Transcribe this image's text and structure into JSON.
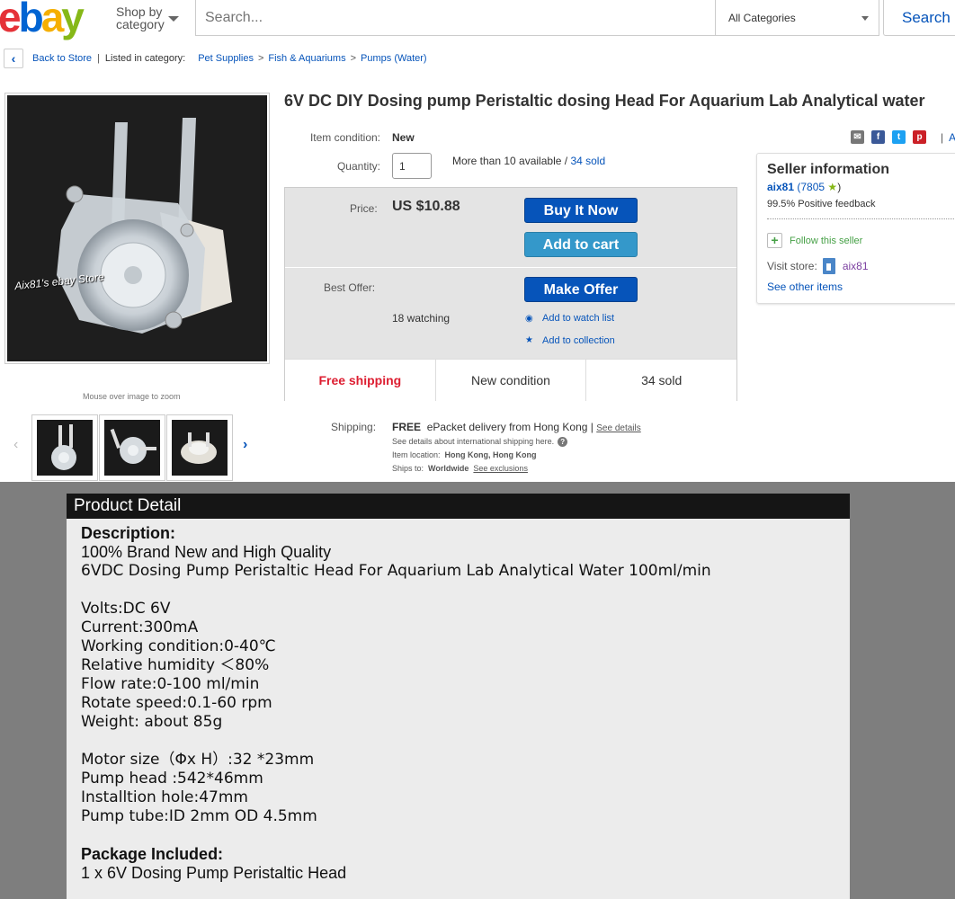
{
  "header": {
    "logo_letters": [
      "e",
      "b",
      "a",
      "y"
    ],
    "logo_colors": [
      "#e53238",
      "#0064d2",
      "#f5af02",
      "#86b817"
    ],
    "shop_by_line1": "Shop by",
    "shop_by_line2": "category",
    "search_placeholder": "Search...",
    "category_select": "All Categories",
    "search_button": "Search"
  },
  "breadcrumb": {
    "back": "Back to Store",
    "listed_in": "Listed in category:",
    "categories": [
      "Pet Supplies",
      "Fish & Aquariums",
      "Pumps (Water)"
    ]
  },
  "gallery": {
    "watermark": "Aix81's ebay Store",
    "zoom_hint": "Mouse over image to zoom"
  },
  "listing": {
    "title": "6V DC DIY Dosing pump Peristaltic dosing Head For Aquarium Lab Analytical water",
    "condition_label": "Item condition:",
    "condition_value": "New",
    "quantity_label": "Quantity:",
    "quantity_value": "1",
    "availability": "More than 10 available /",
    "sold_link": "34 sold",
    "add_link": "Ad",
    "price_label": "Price:",
    "price_value": "US $10.88",
    "buy_now": "Buy It Now",
    "add_to_cart": "Add to cart",
    "best_offer_label": "Best Offer:",
    "make_offer": "Make Offer",
    "watching": "18 watching",
    "watch_list": "Add to watch list",
    "collection": "Add to collection",
    "badges": [
      "Free shipping",
      "New condition",
      "34 sold"
    ]
  },
  "shipping": {
    "label": "Shipping:",
    "free": "FREE",
    "method": "ePacket delivery from Hong Kong |",
    "see_details": "See details",
    "intl_note": "See details about international shipping here.",
    "location_label": "Item location:",
    "location_value": "Hong Kong, Hong Kong",
    "ships_label": "Ships to:",
    "ships_value": "Worldwide",
    "see_exclusions": "See exclusions"
  },
  "seller": {
    "heading": "Seller information",
    "name": "aix81",
    "score": "(7805",
    "score_close": ")",
    "feedback": "99.5% Positive feedback",
    "follow": "Follow this seller",
    "visit_label": "Visit store:",
    "store_name": "aix81",
    "other_items": "See other items"
  },
  "product_detail": {
    "heading": "Product Detail",
    "description_label": "Description:",
    "line1": "100% Brand New and High Quality",
    "line2": "6VDC Dosing Pump Peristaltic Head For Aquarium Lab Analytical Water 100ml/min",
    "specs1": [
      "Volts:DC 6V",
      "Current:300mA",
      "Working condition:0-40℃",
      "Relative humidity ＜80%",
      "Flow rate:0-100 ml/min",
      "Rotate speed:0.1-60 rpm",
      "Weight: about 85g"
    ],
    "specs2": [
      "Motor size（Φx H）:32 *23mm",
      "Pump head :542*46mm",
      "Installtion hole:47mm",
      "Pump tube:ID 2mm OD 4.5mm"
    ],
    "package_label": "Package Included:",
    "package_item": "1 x 6V Dosing Pump Peristaltic Head"
  },
  "colors": {
    "link": "#0654ba",
    "buy_button": "#0654ba",
    "cart_button": "#3498ca",
    "free_shipping": "#dd1e31",
    "lower_bg": "#7e7e7e"
  },
  "icons": [
    "back-chevron-icon",
    "caret-down-icon",
    "email-icon",
    "facebook-icon",
    "twitter-icon",
    "pinterest-icon",
    "eye-icon",
    "star-icon",
    "plus-icon",
    "store-icon",
    "question-icon"
  ]
}
